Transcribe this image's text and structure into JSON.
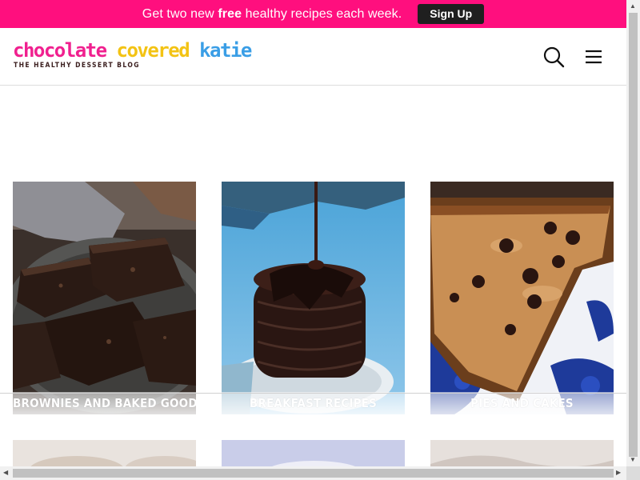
{
  "promo": {
    "text_before": "Get two new ",
    "text_bold": "free",
    "text_after": " healthy recipes each week.",
    "button_label": "Sign Up",
    "bg_color": "#ff0f7e"
  },
  "header": {
    "logo": {
      "word1": "chocolate",
      "word2": " covered",
      "word3": " katie",
      "tagline": "THE HEALTHY DESSERT BLOG"
    },
    "icons": [
      "search-icon",
      "hamburger-menu-icon"
    ]
  },
  "categories": [
    {
      "label": "BROWNIES AND BAKED GOODS"
    },
    {
      "label": "BREAKFAST RECIPES"
    },
    {
      "label": "PIES AND CAKES"
    }
  ],
  "colors": {
    "logo_pink": "#f0208f",
    "logo_yellow": "#f3c314",
    "logo_blue": "#3a9ee6",
    "button_dark": "#1f1f1f"
  }
}
